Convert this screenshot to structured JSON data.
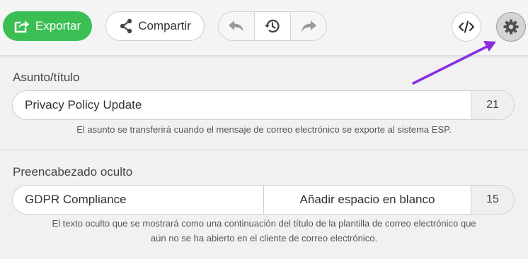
{
  "toolbar": {
    "export_label": "Exportar",
    "share_label": "Compartir",
    "icons": {
      "export": "share-box-icon",
      "share": "share-nodes-icon",
      "undo": "undo-icon",
      "history": "history-icon",
      "redo": "redo-icon",
      "code": "code-icon",
      "settings": "gear-icon"
    }
  },
  "colors": {
    "export_green": "#3bbf55",
    "annotation_arrow": "#8a2be2"
  },
  "subject": {
    "label": "Asunto/título",
    "value": "Privacy Policy Update",
    "count": "21",
    "hint": "El asunto se transferirá cuando el mensaje de correo electrónico se exporte al sistema ESP."
  },
  "preheader": {
    "label": "Preencabezado oculto",
    "value": "GDPR Compliance",
    "add_space_label": "Añadir espacio en blanco",
    "count": "15",
    "hint_line1": "El texto oculto que se mostrará como una continuación del título de la plantilla de correo electrónico que",
    "hint_line2": "aún no se ha abierto en el cliente de correo electrónico."
  }
}
